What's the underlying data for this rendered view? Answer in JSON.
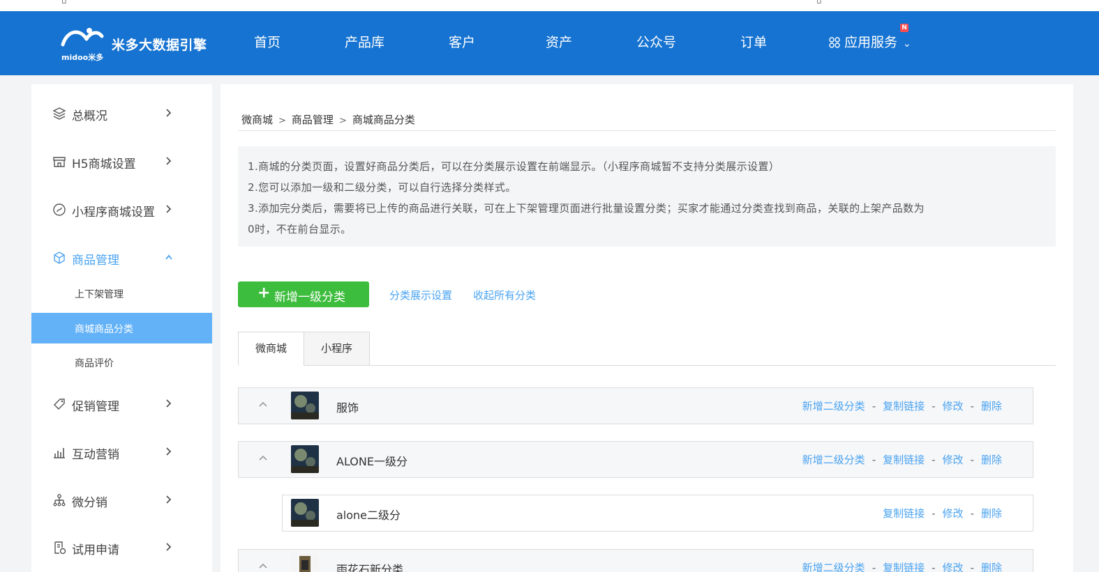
{
  "header": {
    "brand": "米多大数据引擎",
    "brand_sub": "midoo米多",
    "nav": [
      "首页",
      "产品库",
      "客户",
      "资产",
      "公众号",
      "订单"
    ],
    "apps_label": "应用服务",
    "apps_badge": "N",
    "colors": {
      "bar": "#1673d1",
      "badge": "#ff4d4f"
    }
  },
  "sidebar": {
    "items": [
      {
        "label": "总概况",
        "icon": "layers-icon"
      },
      {
        "label": "H5商城设置",
        "icon": "shop-icon"
      },
      {
        "label": "小程序商城设置",
        "icon": "mini-program-icon"
      },
      {
        "label": "商品管理",
        "icon": "cube-icon"
      },
      {
        "label": "促销管理",
        "icon": "tag-icon"
      },
      {
        "label": "互动营销",
        "icon": "bar-chart-icon"
      },
      {
        "label": "微分销",
        "icon": "org-tree-icon"
      },
      {
        "label": "试用申请",
        "icon": "form-icon"
      }
    ],
    "sub_items": [
      "上下架管理",
      "商城商品分类",
      "商品评价"
    ],
    "colors": {
      "active_text": "#4aa3f0",
      "selected_bg": "#63b2f7"
    }
  },
  "breadcrumb": [
    "微商城",
    "商品管理",
    "商城商品分类"
  ],
  "breadcrumb_sep": ">",
  "notice": [
    "1.商城的分类页面，设置好商品分类后，可以在分类展示设置在前端显示。（小程序商城暂不支持分类展示设置）",
    "2.您可以添加一级和二级分类，可以自行选择分类样式。",
    "3.添加完分类后，需要将已上传的商品进行关联，可在上下架管理页面进行批量设置分类；买家才能通过分类查找到商品，关联的上架产品数为",
    "0时，不在前台显示。"
  ],
  "toolbar": {
    "add_label": "新增一级分类",
    "display_settings": "分类展示设置",
    "collapse_all": "收起所有分类",
    "add_color": "#3dbd3d"
  },
  "tabs": [
    "微商城",
    "小程序"
  ],
  "actions": {
    "add_sub": "新增二级分类",
    "copy_link": "复制链接",
    "edit": "修改",
    "delete": "删除",
    "sep": "-"
  },
  "categories": [
    {
      "name": "服饰",
      "level": 1
    },
    {
      "name": "ALONE一级分",
      "level": 1
    },
    {
      "name": "alone二级分",
      "level": 2
    },
    {
      "name": "雨花石新分类",
      "level": 1
    }
  ]
}
